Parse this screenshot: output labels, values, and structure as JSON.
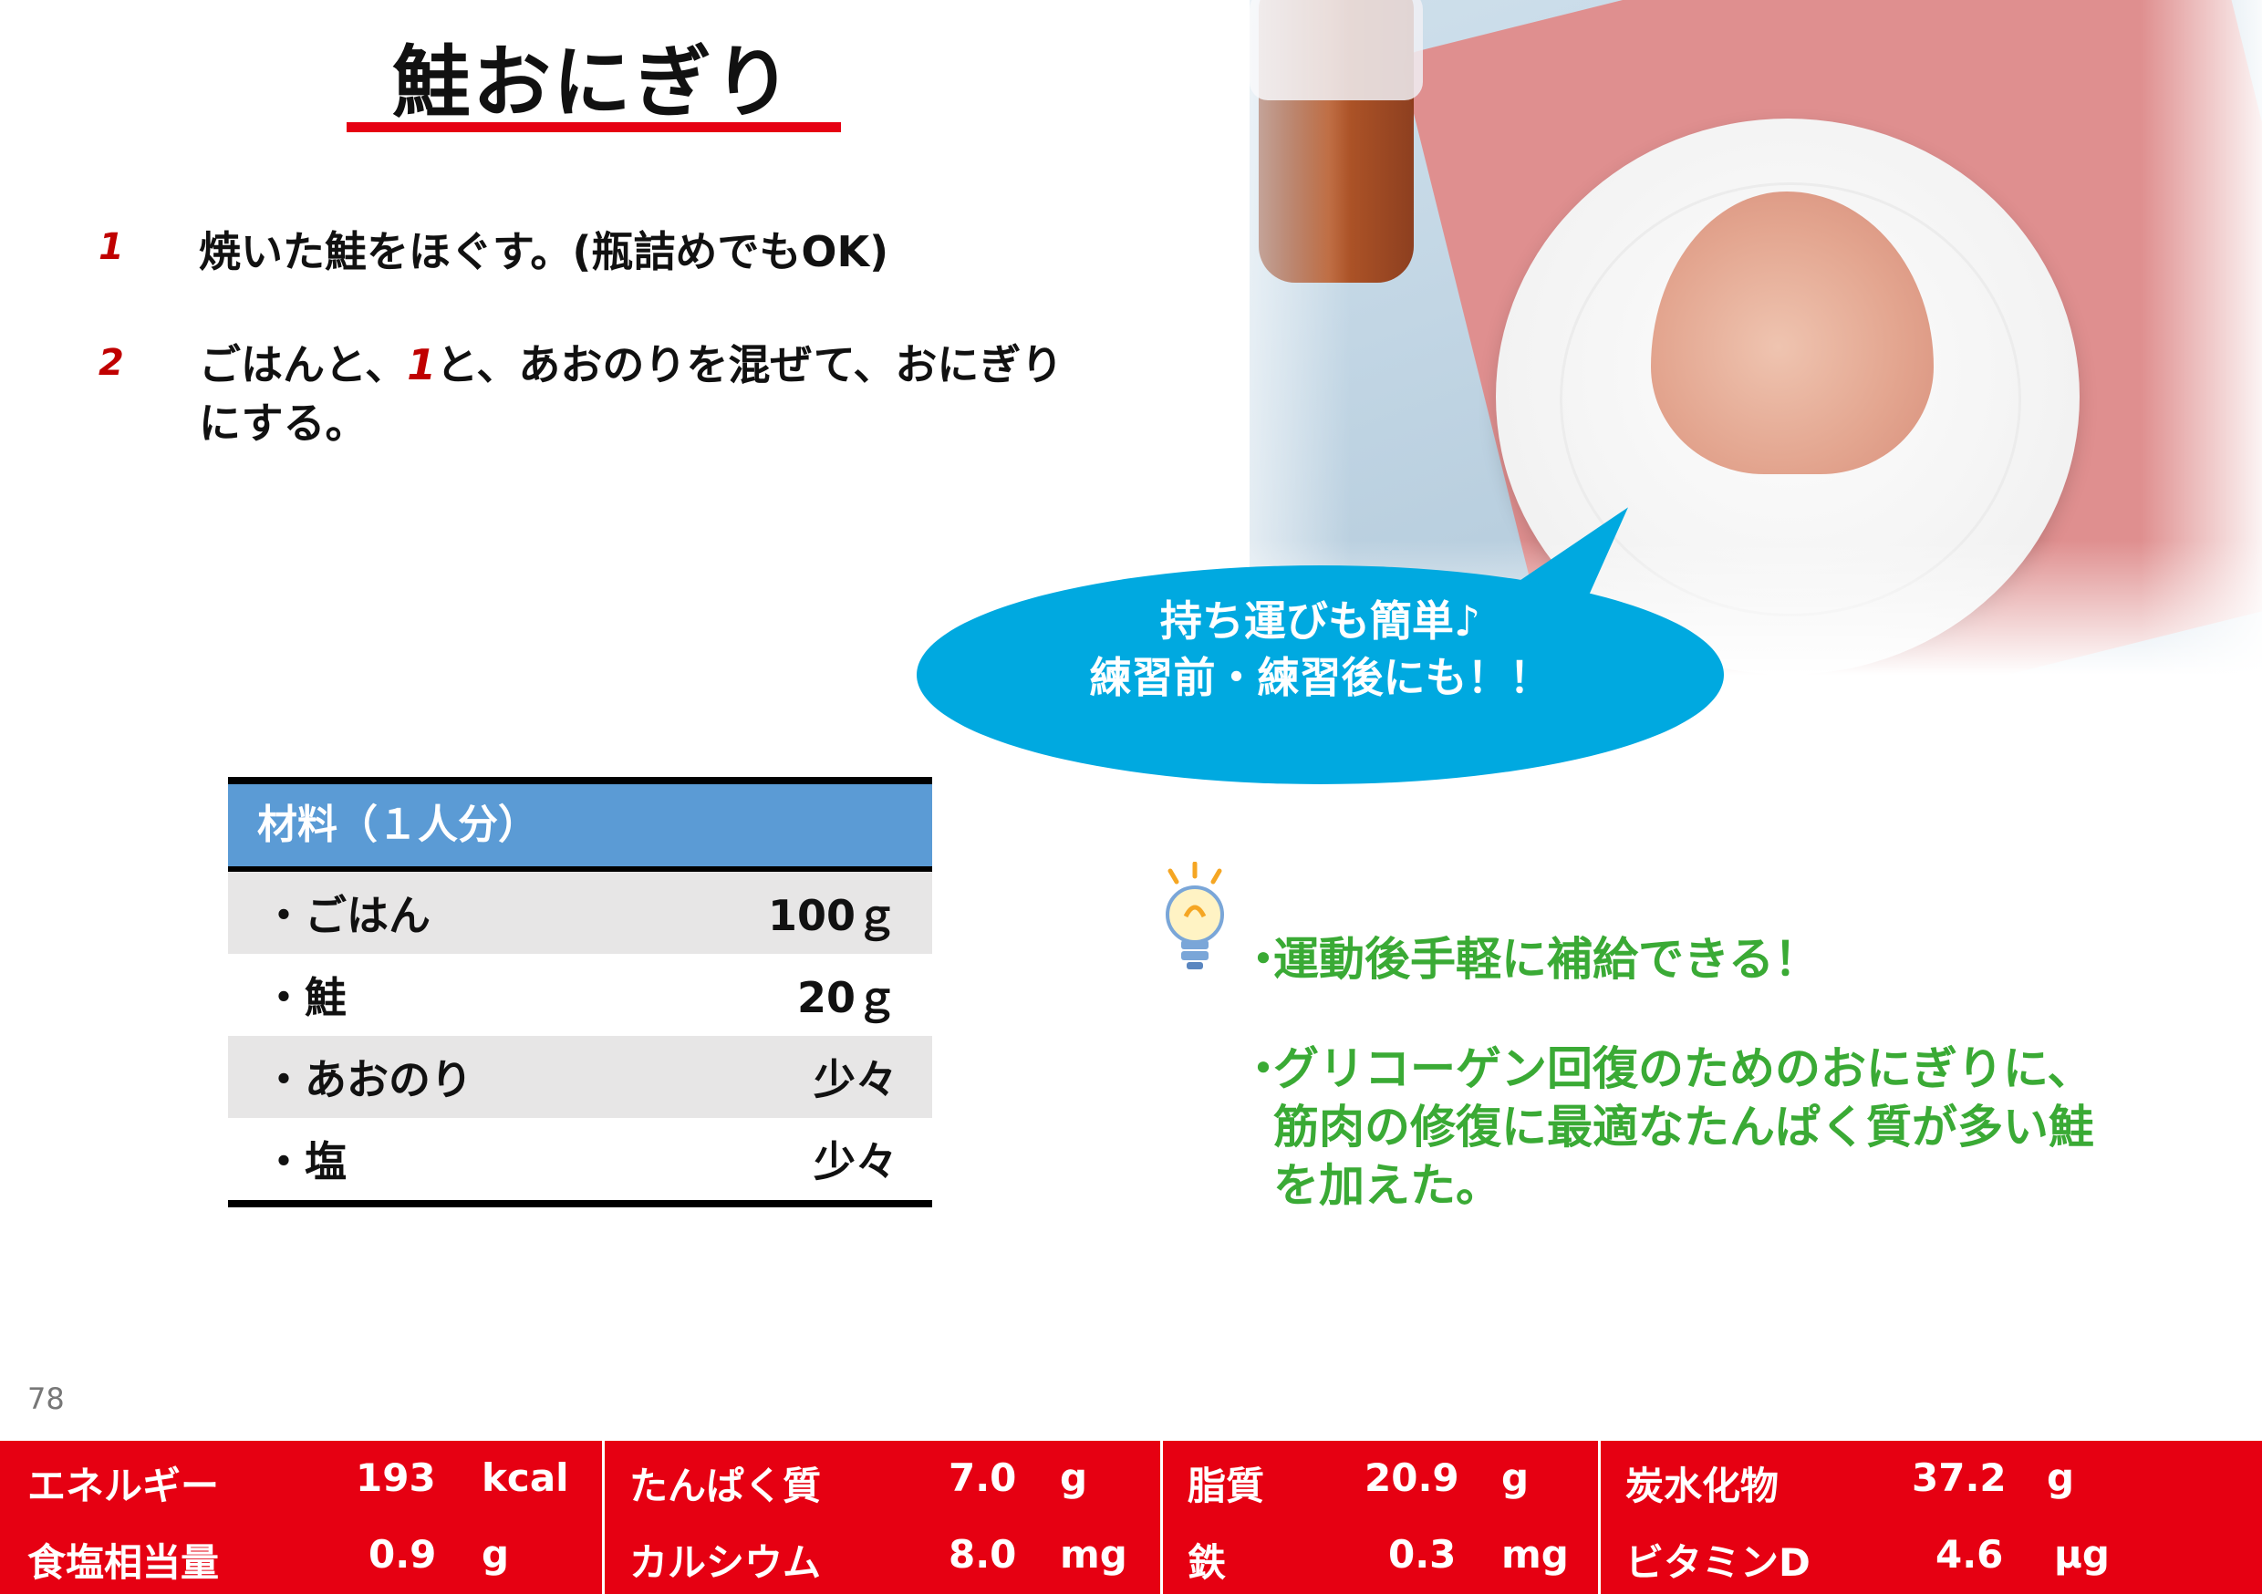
{
  "title": "鮭おにぎり",
  "steps": [
    {
      "num": "1",
      "text": "焼いた鮭をほぐす。(瓶詰めでもOK)"
    },
    {
      "num": "2",
      "text_pre": "ごはんと、",
      "ref": "1",
      "text_post": "と、あおのりを混ぜて、おにぎり",
      "text_line2": "にする。"
    }
  ],
  "bubble": {
    "line1": "持ち運びも簡単♪",
    "line2": "練習前・練習後にも！！"
  },
  "ingredients": {
    "header": "材料（１人分）",
    "items": [
      {
        "name": "・ごはん",
        "amount": "100ｇ"
      },
      {
        "name": "・鮭",
        "amount": "20ｇ"
      },
      {
        "name": "・あおのり",
        "amount": "少々"
      },
      {
        "name": "・塩",
        "amount": "少々"
      }
    ]
  },
  "tips": [
    {
      "bullet": "・",
      "lines": [
        "運動後手軽に補給できる！"
      ]
    },
    {
      "bullet": "・",
      "lines": [
        "グリコーゲン回復のためのおにぎりに、",
        "筋肉の修復に最適なたんぱく質が多い鮭",
        "を加えた。"
      ]
    }
  ],
  "page_number": "78",
  "nutrition": [
    {
      "label": "エネルギー",
      "value": "193",
      "unit": "kcal"
    },
    {
      "label": "たんぱく質",
      "value": "7.0",
      "unit": "g"
    },
    {
      "label": "脂質",
      "value": "20.9",
      "unit": "g"
    },
    {
      "label": "炭水化物",
      "value": "37.2",
      "unit": "g"
    },
    {
      "label": "食塩相当量",
      "value": "0.9",
      "unit": "g"
    },
    {
      "label": "カルシウム",
      "value": "8.0",
      "unit": "mg"
    },
    {
      "label": "鉄",
      "value": "0.3",
      "unit": "mg"
    },
    {
      "label": "ビタミンD",
      "value": "4.6",
      "unit": "μg"
    }
  ],
  "colors": {
    "accent_red": "#e60012",
    "bubble_blue": "#00a9e0",
    "table_header_blue": "#5b9bd5",
    "tip_green": "#3aaa35"
  }
}
